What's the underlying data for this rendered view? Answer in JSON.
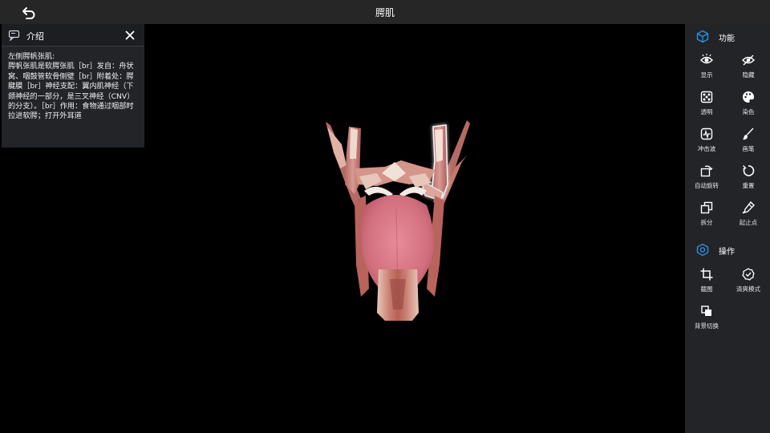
{
  "header": {
    "title": "腭肌"
  },
  "intro": {
    "title": "介绍",
    "heading": "左侧腭帆张肌:",
    "body": "腭帆张肌是软腭张肌［br］发自：舟状窝、咽鼓管软骨侧壁［br］附着处：腭腱膜［br］神经支配：翼内肌神经（下颌神经的一部分，是三叉神经（CNV）的分支）。［br］作用：食物通过咽部时拉进软腭；打开外耳道"
  },
  "panel": {
    "functions_label": "功能",
    "operations_label": "操作",
    "tools": [
      {
        "label": "显示",
        "icon": "eye-icon"
      },
      {
        "label": "隐藏",
        "icon": "eye-off-icon"
      },
      {
        "label": "透明",
        "icon": "dice-icon"
      },
      {
        "label": "染色",
        "icon": "palette-icon"
      },
      {
        "label": "冲击波",
        "icon": "shockwave-icon"
      },
      {
        "label": "画笔",
        "icon": "brush-icon"
      },
      {
        "label": "自动旋转",
        "icon": "auto-rotate-icon"
      },
      {
        "label": "重置",
        "icon": "reset-icon"
      },
      {
        "label": "拆分",
        "icon": "split-icon"
      },
      {
        "label": "起止点",
        "icon": "origin-insertion-icon"
      }
    ],
    "operations": [
      {
        "label": "截图",
        "icon": "crop-icon"
      },
      {
        "label": "清爽模式",
        "icon": "clean-mode-icon"
      },
      {
        "label": "背景切换",
        "icon": "background-switch-icon"
      }
    ]
  },
  "colors": {
    "accent": "#2f8fe0",
    "panel_bg": "#222428",
    "topbar_bg": "#262626",
    "muscle": "#c97a7a",
    "tongue": "#d9707e"
  }
}
